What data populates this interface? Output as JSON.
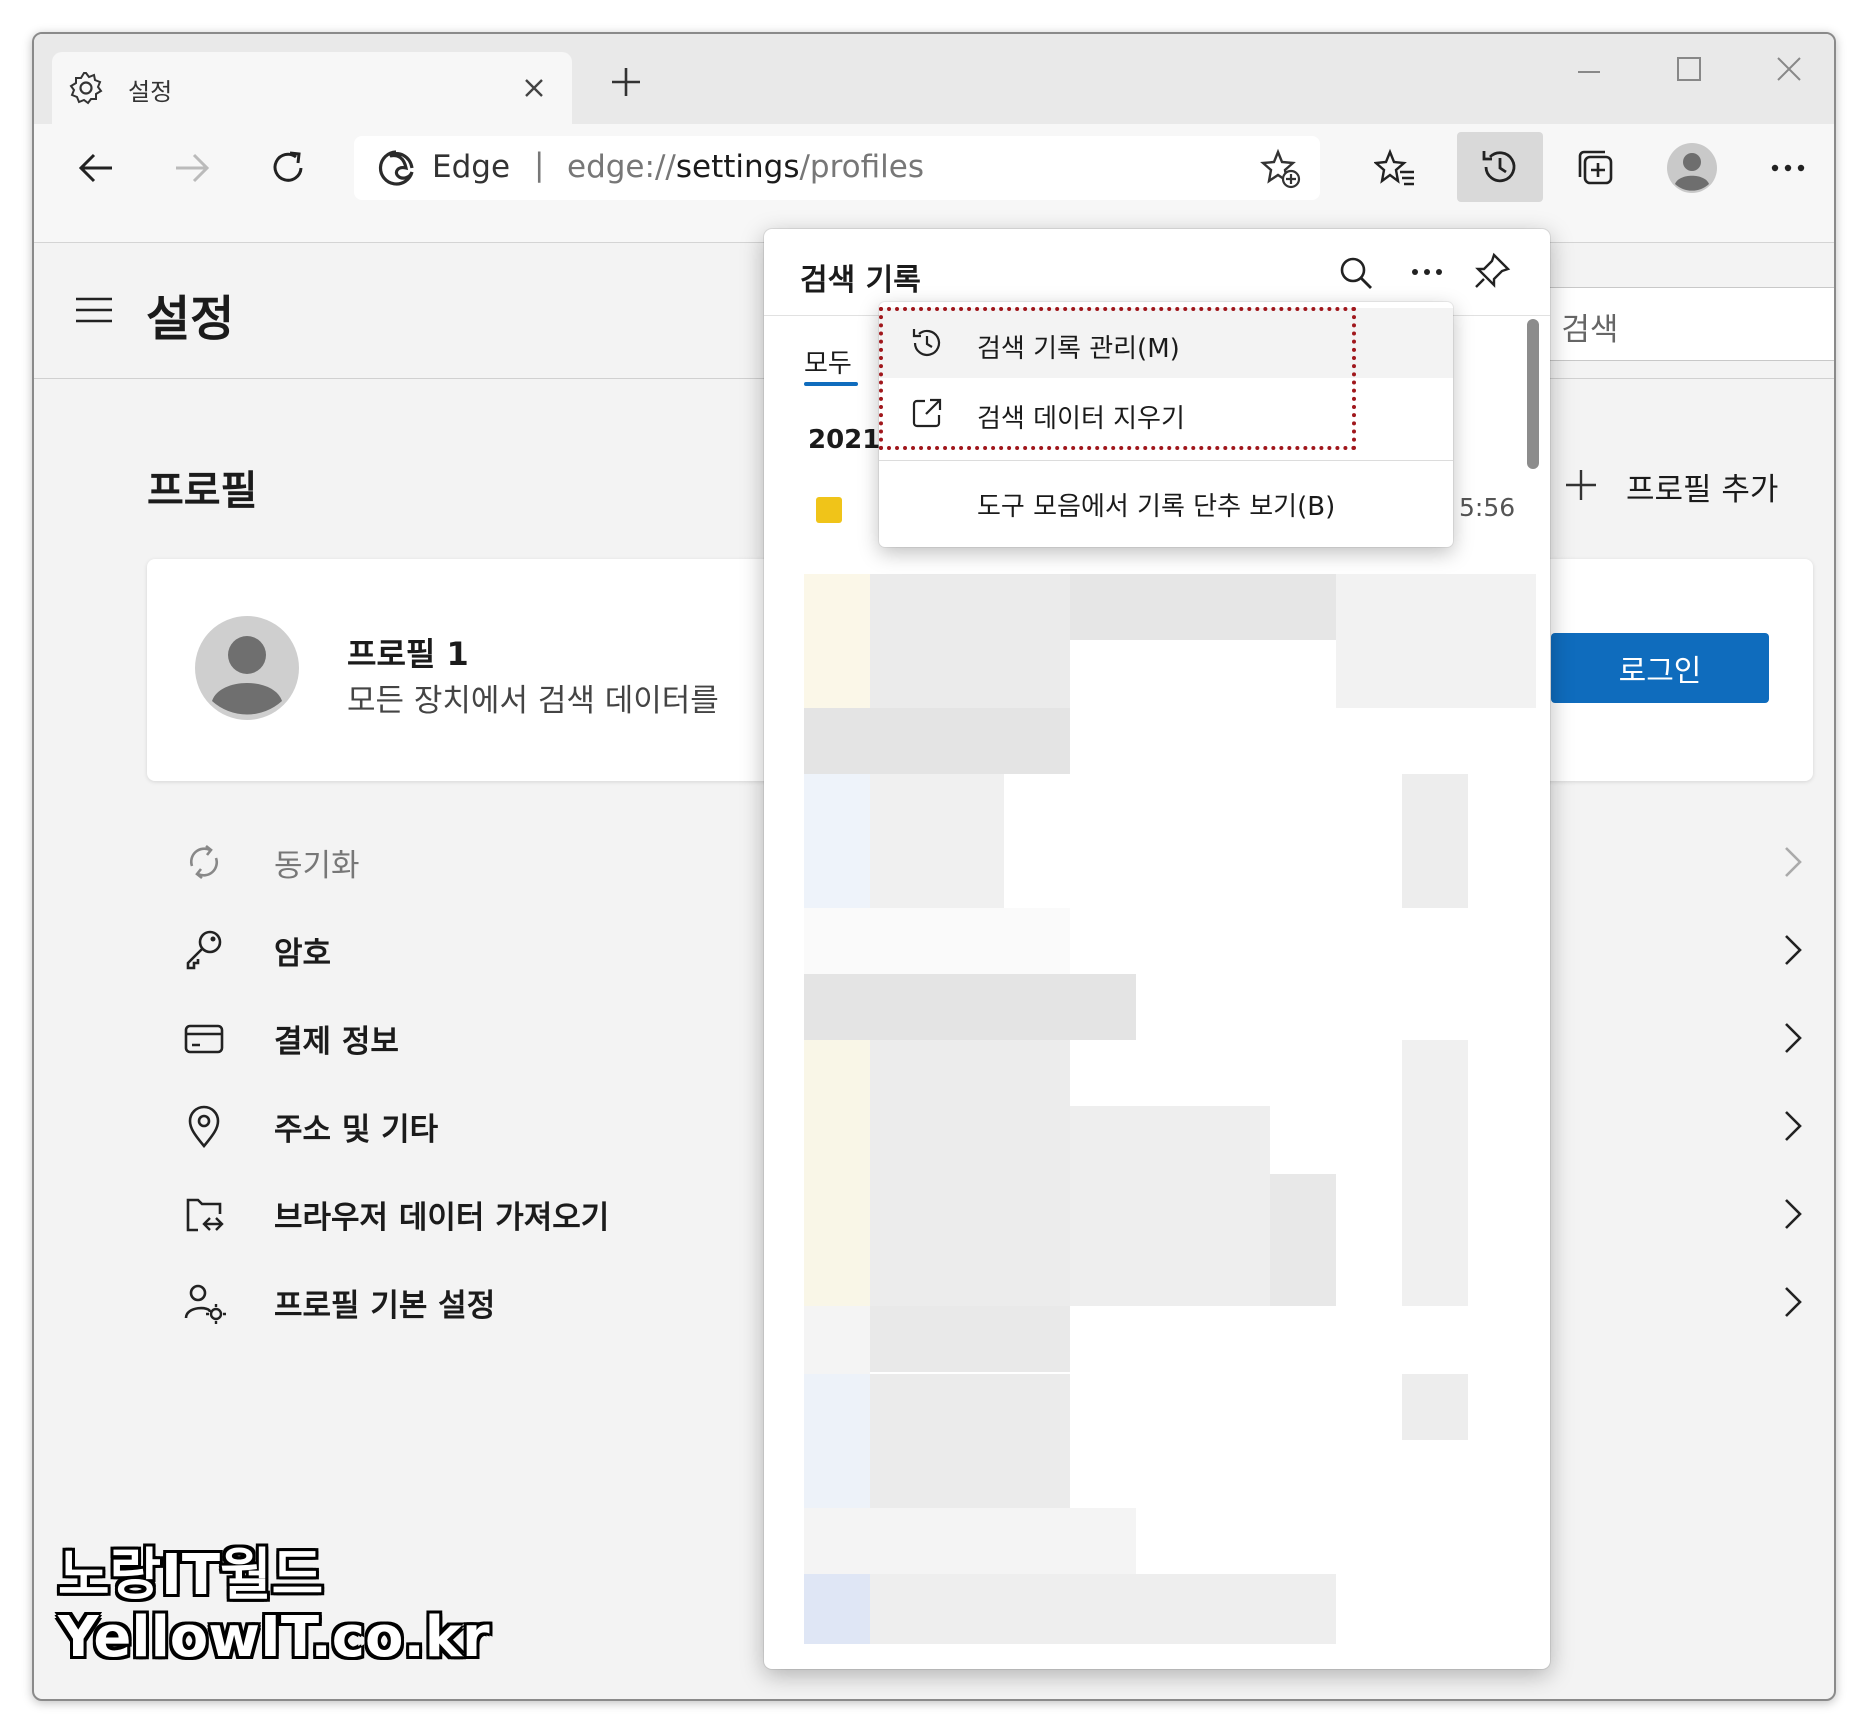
{
  "tab": {
    "title": "설정",
    "icon": "gear-icon",
    "close_icon": "close-icon",
    "new_tab_icon": "plus-icon"
  },
  "window_controls": [
    "minimize-icon",
    "maximize-icon",
    "close-icon"
  ],
  "address": {
    "site_label": "Edge",
    "separator": "|",
    "url_prefix": "edge://",
    "url_main": "settings",
    "url_suffix": "/profiles"
  },
  "toolbar_icons": [
    "back-arrow-icon",
    "forward-arrow-icon",
    "refresh-icon",
    "add-favorite-icon",
    "favorites-icon",
    "history-icon",
    "collections-icon",
    "avatar-icon",
    "more-icon"
  ],
  "settings": {
    "title": "설정",
    "search_placeholder": "정 검색",
    "profile_section_title": "프로필",
    "add_profile_label": "프로필 추가",
    "profile_name": "프로필 1",
    "profile_desc": "모든 장치에서 검색 데이터를",
    "login_label": "로그인",
    "menu": [
      {
        "label": "동기화",
        "icon": "sync-icon",
        "muted": true
      },
      {
        "label": "암호",
        "icon": "key-icon"
      },
      {
        "label": "결제 정보",
        "icon": "credit-card-icon"
      },
      {
        "label": "주소 및 기타",
        "icon": "location-pin-icon"
      },
      {
        "label": "브라우저 데이터 가져오기",
        "icon": "import-folder-icon"
      },
      {
        "label": "프로필 기본 설정",
        "icon": "profile-settings-icon"
      }
    ]
  },
  "history_panel": {
    "title": "검색 기록",
    "tab_all": "모두",
    "date_heading_partial": "2021",
    "entry_time_partial": "5:56",
    "context_menu": [
      {
        "label": "검색 기록 관리(M)",
        "icon": "history-icon"
      },
      {
        "label": "검색 데이터 지우기",
        "icon": "open-external-icon"
      },
      {
        "label": "도구 모음에서 기록 단추 보기(B)",
        "icon": ""
      }
    ]
  },
  "colors": {
    "accent": "#0f6cbd",
    "highlight_box": "#a0171c",
    "titlebar": "#e9e9e9",
    "page_bg": "#f3f3f3"
  },
  "watermark": {
    "line1": "노랑IT월드",
    "line2": "YellowIT.co.kr"
  }
}
